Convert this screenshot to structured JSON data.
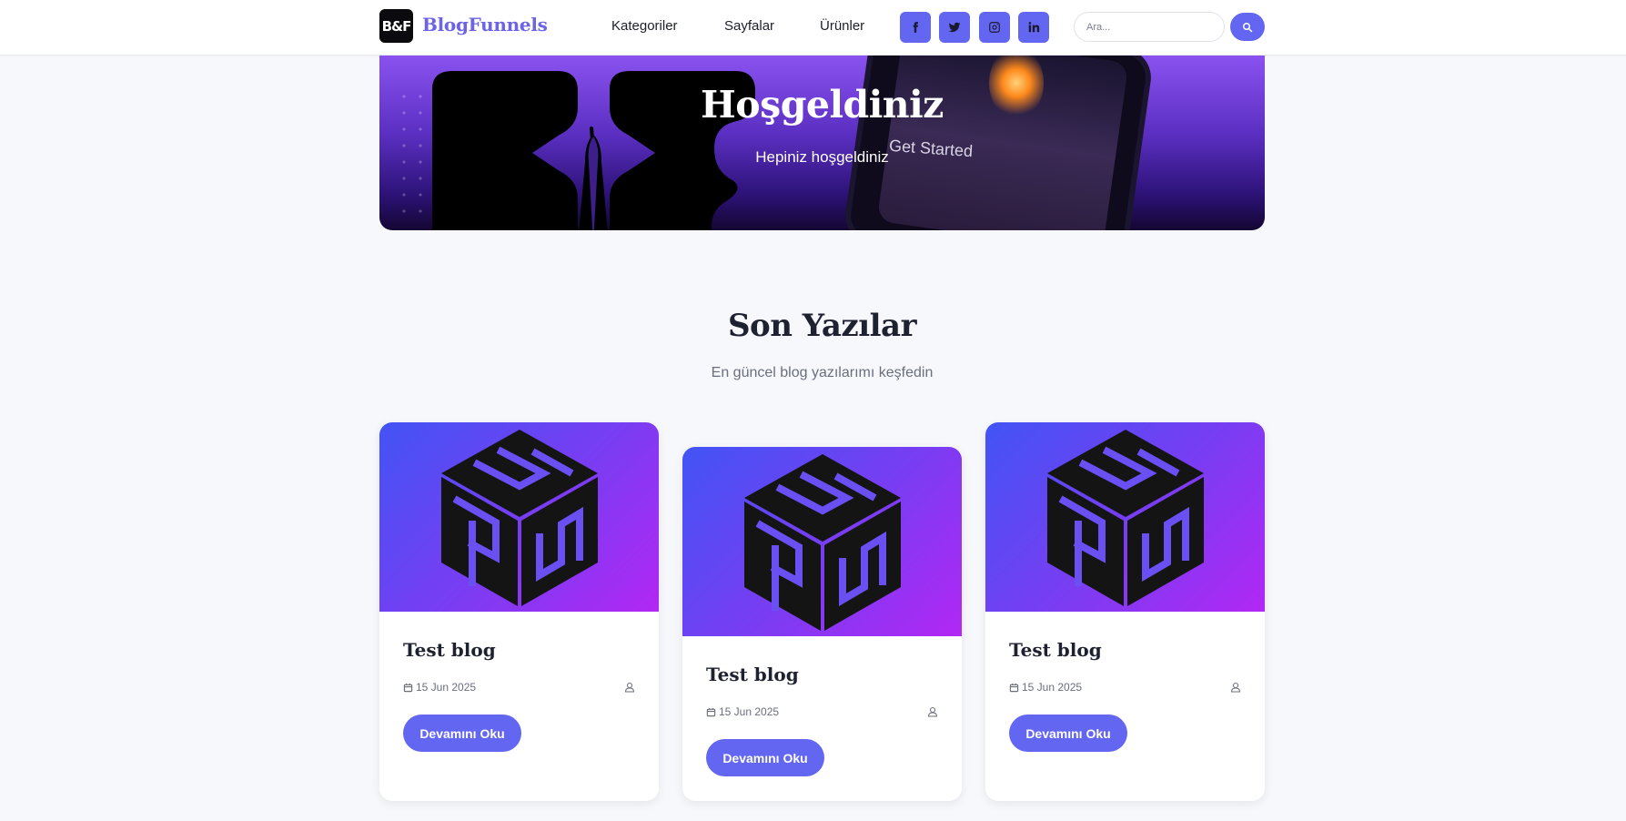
{
  "header": {
    "logo_text": "B&F",
    "brand": "BlogFunnels",
    "nav": [
      "Kategoriler",
      "Sayfalar",
      "Ürünler"
    ],
    "social": [
      "facebook-icon",
      "twitter-icon",
      "instagram-icon",
      "linkedin-icon"
    ],
    "search": {
      "placeholder": "Ara...",
      "value": ""
    }
  },
  "hero": {
    "title": "Hoşgeldiniz",
    "subtitle": "Hepiniz hoşgeldiniz",
    "image_text": "Get Started"
  },
  "section": {
    "title": "Son Yazılar",
    "subtitle": "En güncel blog yazılarımı keşfedin"
  },
  "posts": [
    {
      "title": "Test blog",
      "date": "15 Jun 2025",
      "button": "Devamını Oku"
    },
    {
      "title": "Test blog",
      "date": "15 Jun 2025",
      "button": "Devamını Oku"
    },
    {
      "title": "Test blog",
      "date": "15 Jun 2025",
      "button": "Devamını Oku"
    }
  ],
  "colors": {
    "accent": "#6366f1",
    "brand": "#6c63e6",
    "background": "#f7f8fb",
    "text": "#1e2130"
  }
}
